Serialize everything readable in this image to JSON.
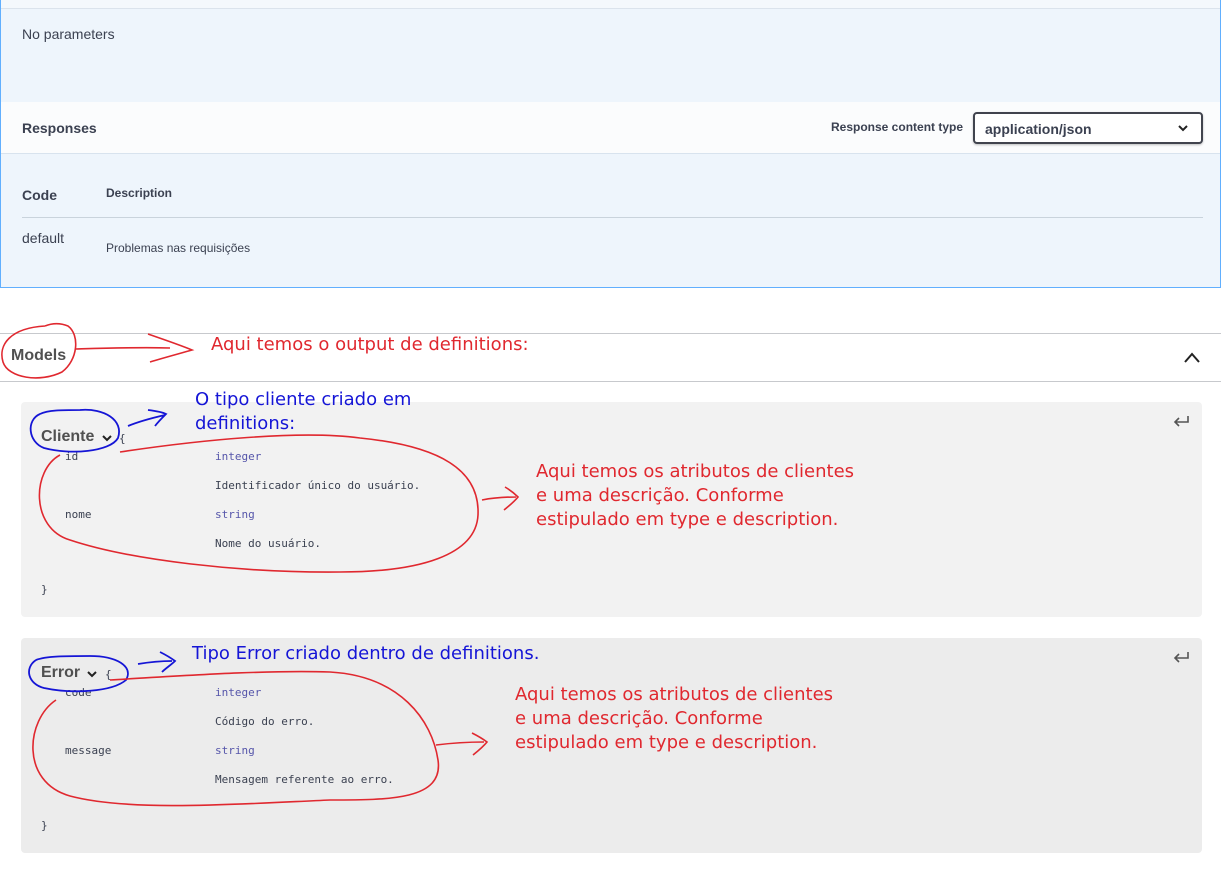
{
  "operation": {
    "no_parameters": "No parameters",
    "responses_title": "Responses",
    "response_content_type_label": "Response content type",
    "response_content_type_value": "application/json",
    "table": {
      "code_header": "Code",
      "description_header": "Description",
      "rows": [
        {
          "code": "default",
          "description": "Problemas nas requisições"
        }
      ]
    }
  },
  "models": {
    "title": "Models",
    "items": [
      {
        "name": "Cliente",
        "open_brace": "{",
        "close_brace": "}",
        "properties": [
          {
            "name": "id",
            "type": "integer",
            "description": "Identificador único do usuário."
          },
          {
            "name": "nome",
            "type": "string",
            "description": "Nome do usuário."
          }
        ]
      },
      {
        "name": "Error",
        "open_brace": "{",
        "close_brace": "}",
        "properties": [
          {
            "name": "code",
            "type": "integer",
            "description": "Código do erro."
          },
          {
            "name": "message",
            "type": "string",
            "description": "Mensagem referente ao erro."
          }
        ]
      }
    ]
  },
  "annotations": {
    "models_note": "Aqui temos o output de definitions:",
    "cliente_type_note": [
      "O tipo cliente criado em",
      "definitions:"
    ],
    "cliente_attrs_note": [
      "Aqui temos os atributos de clientes",
      "e uma descrição. Conforme",
      "estipulado em type e description."
    ],
    "error_type_note": "Tipo Error criado dentro de definitions.",
    "error_attrs_note": [
      "Aqui temos os atributos de clientes",
      "e uma descrição. Conforme",
      "estipulado em type e description."
    ]
  },
  "colors": {
    "annotation_red": "#e0282f",
    "annotation_blue": "#1515d6",
    "get_border": "#61affe",
    "type_color": "#55a"
  },
  "icons": [
    "chevron-down-icon",
    "chevron-up-icon",
    "return-icon"
  ]
}
